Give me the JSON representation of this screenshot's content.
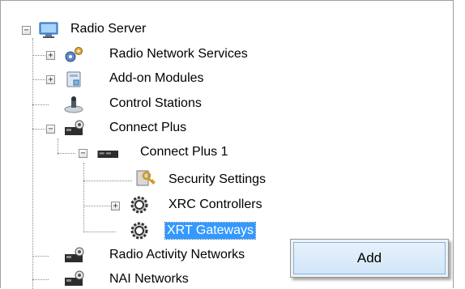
{
  "tree": {
    "root": {
      "label": "Radio Server",
      "icon": "server-icon",
      "expander": "−"
    },
    "radio_network_services": {
      "label": "Radio Network Services",
      "icon": "network-gear-icon",
      "expander": "+"
    },
    "addon_modules": {
      "label": "Add-on Modules",
      "icon": "module-icon",
      "expander": "+"
    },
    "control_stations": {
      "label": "Control Stations",
      "icon": "radio-station-icon"
    },
    "connect_plus": {
      "label": "Connect Plus",
      "icon": "connect-plus-icon",
      "expander": "−"
    },
    "connect_plus_1": {
      "label": "Connect Plus 1",
      "icon": "connect-plus-device-icon",
      "expander": "−"
    },
    "security_settings": {
      "label": "Security Settings",
      "icon": "key-icon"
    },
    "xrc_controllers": {
      "label": "XRC Controllers",
      "icon": "gear-icon",
      "expander": "+"
    },
    "xrt_gateways": {
      "label": "XRT Gateways",
      "icon": "gear-icon"
    },
    "radio_activity_networks": {
      "label": "Radio Activity Networks",
      "icon": "connect-plus-icon"
    },
    "nai_networks": {
      "label": "NAI Networks",
      "icon": "connect-plus-icon"
    }
  },
  "context_menu": {
    "items": [
      {
        "label": "Add"
      }
    ]
  }
}
